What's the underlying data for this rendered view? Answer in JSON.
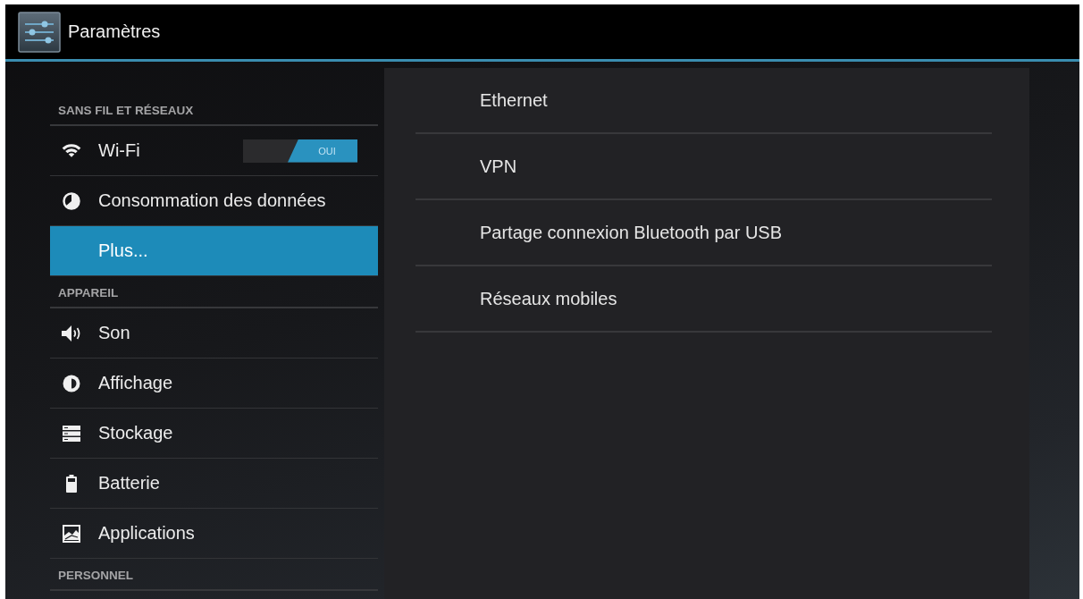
{
  "action_bar": {
    "title": "Paramètres"
  },
  "sidebar": {
    "sections": [
      {
        "header": "SANS FIL ET RÉSEAUX",
        "items": [
          {
            "label": "Wi-Fi",
            "kind": "switch",
            "selected": false,
            "toggle": {
              "on": true,
              "label": "OUI"
            }
          },
          {
            "label": "Consommation des données",
            "kind": "plain",
            "selected": false
          },
          {
            "label": "Plus...",
            "kind": "plain",
            "selected": true
          }
        ]
      },
      {
        "header": "APPAREIL",
        "items": [
          {
            "label": "Son",
            "kind": "plain",
            "selected": false
          },
          {
            "label": "Affichage",
            "kind": "plain",
            "selected": false
          },
          {
            "label": "Stockage",
            "kind": "plain",
            "selected": false
          },
          {
            "label": "Batterie",
            "kind": "plain",
            "selected": false
          },
          {
            "label": "Applications",
            "kind": "plain",
            "selected": false
          }
        ]
      },
      {
        "header": "PERSONNEL"
      }
    ]
  },
  "details": {
    "items": [
      "Ethernet",
      "VPN",
      "Partage connexion Bluetooth par USB",
      "Réseaux mobiles"
    ]
  }
}
